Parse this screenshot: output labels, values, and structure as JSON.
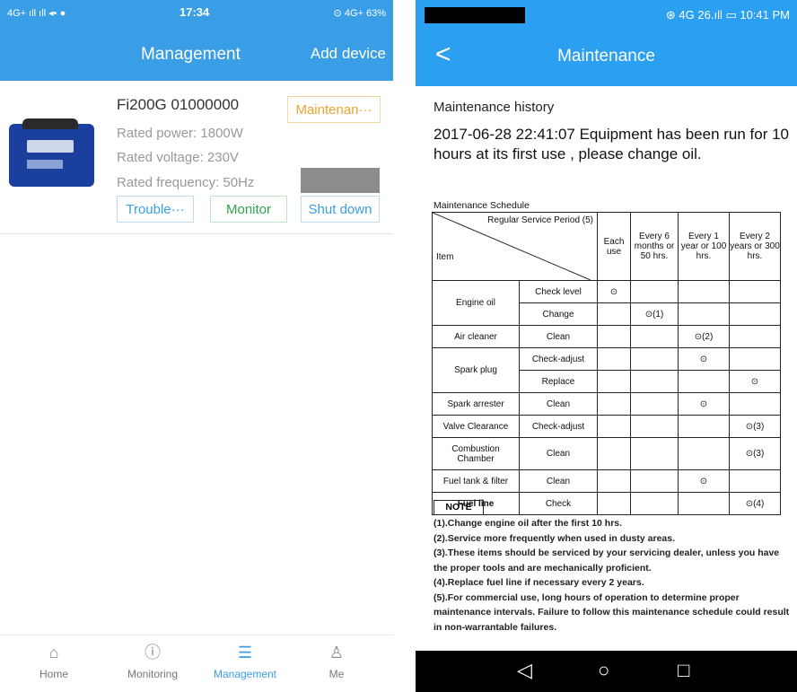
{
  "left": {
    "status": {
      "left_icons": "4G+ ıll ıll ◂• ●",
      "time": "17:34",
      "right_icons": "⊙ 4G+ 63%"
    },
    "header": {
      "title": "Management",
      "add_device": "Add device"
    },
    "device": {
      "name": "Fi200G 01000000",
      "rated_power": "Rated power:  1800W",
      "rated_voltage": "Rated voltage:  230V",
      "rated_frequency": "Rated frequency:  50Hz",
      "buttons": {
        "maintenance": "Maintenan···",
        "trouble": "Trouble···",
        "monitor": "Monitor",
        "shutdown": "Shut down"
      }
    },
    "tabs": [
      {
        "label": "Home",
        "icon": "home-icon"
      },
      {
        "label": "Monitoring",
        "icon": "monitoring-icon"
      },
      {
        "label": "Management",
        "icon": "management-icon"
      },
      {
        "label": "Me",
        "icon": "me-icon"
      }
    ],
    "accent": "#3a9ee6"
  },
  "right": {
    "status": {
      "right_icons": "⊛ 4G 26.ıll ▭ 10:41 PM"
    },
    "header": {
      "title": "Maintenance",
      "back_icon": "back-icon"
    },
    "history_title": "Maintenance history",
    "history_entry": "2017-06-28 22:41:07 Equipment has been run for 10 hours at its first use , please change oil.",
    "schedule": {
      "title": "Maintenance Schedule",
      "header_top": "Regular Service Period (5)",
      "header_item": "Item",
      "periods": [
        "Each use",
        "Every 6 months or 50 hrs.",
        "Every 1 year or 100 hrs.",
        "Every 2 years or 300 hrs."
      ],
      "rows": [
        {
          "item": "Engine oil",
          "action": "Check level",
          "marks": [
            "⊙",
            "",
            "",
            ""
          ]
        },
        {
          "item": "",
          "action": "Change",
          "marks": [
            "",
            "⊙(1)",
            "",
            ""
          ]
        },
        {
          "item": "Air cleaner",
          "action": "Clean",
          "marks": [
            "",
            "",
            "⊙(2)",
            ""
          ]
        },
        {
          "item": "Spark plug",
          "action": "Check-adjust",
          "marks": [
            "",
            "",
            "⊙",
            ""
          ]
        },
        {
          "item": "",
          "action": "Replace",
          "marks": [
            "",
            "",
            "",
            "⊙"
          ]
        },
        {
          "item": "Spark arrester",
          "action": "Clean",
          "marks": [
            "",
            "",
            "⊙",
            ""
          ]
        },
        {
          "item": "Valve Clearance",
          "action": "Check-adjust",
          "marks": [
            "",
            "",
            "",
            "⊙(3)"
          ]
        },
        {
          "item": "Combustion Chamber",
          "action": "Clean",
          "marks": [
            "",
            "",
            "",
            "⊙(3)"
          ]
        },
        {
          "item": "Fuel tank & filter",
          "action": "Clean",
          "marks": [
            "",
            "",
            "⊙",
            ""
          ]
        },
        {
          "item": "Fuel line",
          "action": "Check",
          "marks": [
            "",
            "",
            "",
            "⊙(4)"
          ]
        }
      ]
    },
    "note_label": "NOTE",
    "notes": [
      "(1).Change engine oil after the first 10 hrs.",
      "(2).Service more frequently when used in dusty areas.",
      "(3).These items should be serviced by your servicing dealer, unless you have the proper tools and are mechanically proficient.",
      "(4).Replace fuel line if necessary every 2 years.",
      "(5).For commercial use, long hours of operation to determine proper maintenance intervals. Failure to follow this maintenance schedule could result in non-warrantable failures."
    ],
    "nav": {
      "back": "◁",
      "home": "○",
      "recent": "□"
    },
    "accent": "#2b9ff0"
  }
}
